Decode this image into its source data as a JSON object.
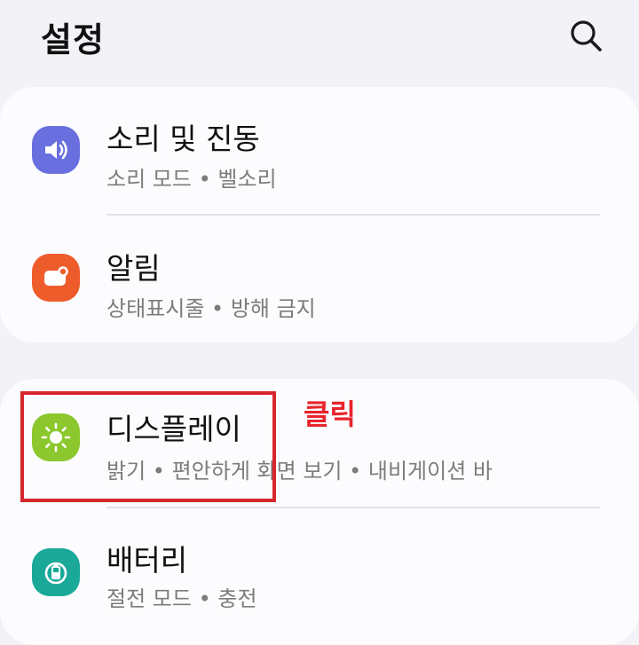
{
  "header": {
    "title": "설정",
    "search_icon": "search-icon"
  },
  "groups": [
    {
      "items": [
        {
          "title": "소리 및 진동",
          "subtitle": "소리 모드  •  벨소리",
          "icon": "volume-icon",
          "icon_color": "#6a6fdf"
        },
        {
          "title": "알림",
          "subtitle": "상태표시줄  •  방해 금지",
          "icon": "notification-icon",
          "icon_color": "#ee5c2c"
        }
      ]
    },
    {
      "items": [
        {
          "title": "디스플레이",
          "subtitle": "밝기  •  편안하게 화면 보기  •  내비게이션 바",
          "icon": "brightness-icon",
          "icon_color": "#8cc72d"
        },
        {
          "title": "배터리",
          "subtitle": "절전 모드  •  충전",
          "icon": "battery-icon",
          "icon_color": "#1aa899"
        }
      ]
    }
  ],
  "annotation": {
    "label": "클릭",
    "color": "#e8242c"
  }
}
